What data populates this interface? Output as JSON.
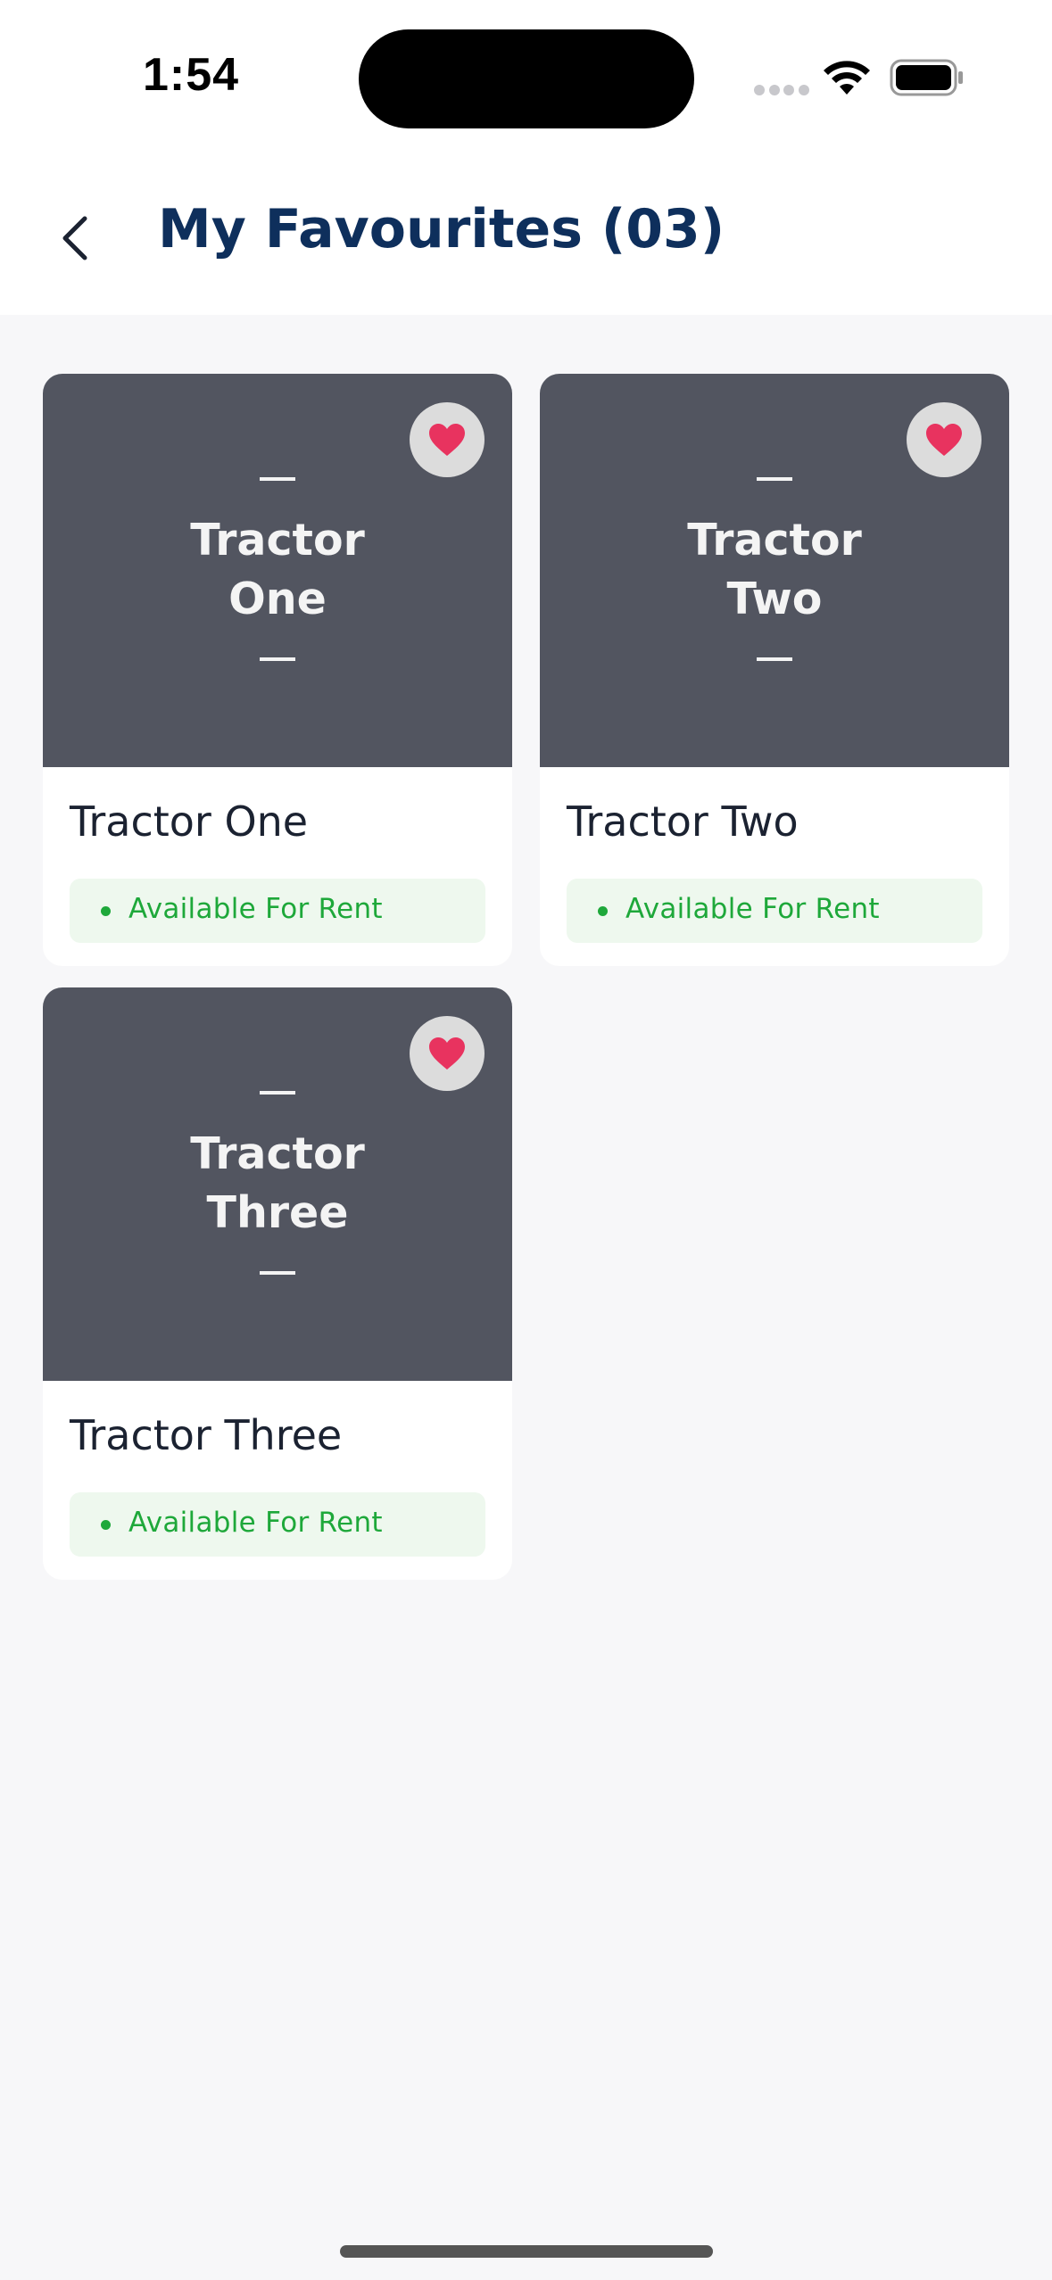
{
  "status_bar": {
    "time": "1:54"
  },
  "header": {
    "title": "My Favourites (03)",
    "back_icon": "chevron-left-icon"
  },
  "favourites": [
    {
      "image_label_line1": "Tractor",
      "image_label_line2": "One",
      "name": "Tractor One",
      "status": "Available For Rent",
      "favourite_icon": "heart-icon"
    },
    {
      "image_label_line1": "Tractor",
      "image_label_line2": "Two",
      "name": "Tractor Two",
      "status": "Available For Rent",
      "favourite_icon": "heart-icon"
    },
    {
      "image_label_line1": "Tractor",
      "image_label_line2": "Three",
      "name": "Tractor Three",
      "status": "Available For Rent",
      "favourite_icon": "heart-icon"
    }
  ],
  "colors": {
    "title": "#0e2f5c",
    "heart": "#e8335f",
    "available_text": "#1ea83a",
    "available_bg": "#eef8ee",
    "image_placeholder": "#525560"
  }
}
